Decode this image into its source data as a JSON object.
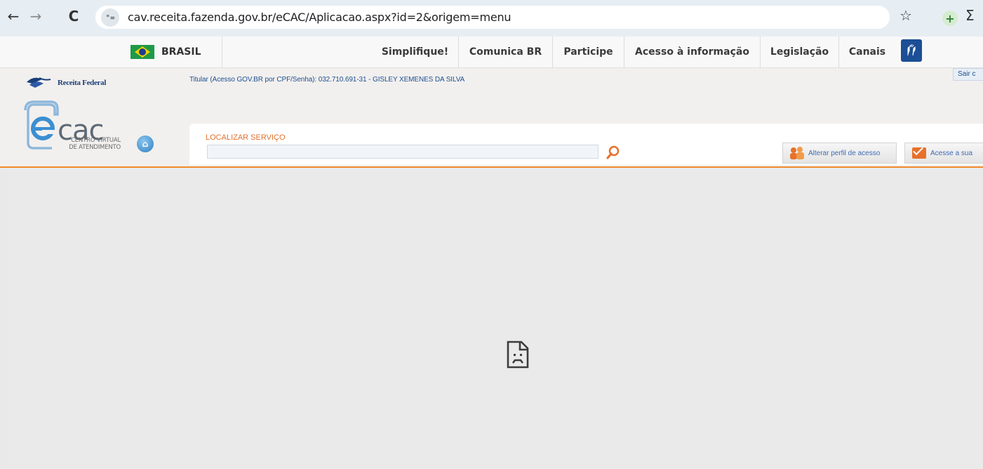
{
  "browser": {
    "back_icon": "←",
    "forward_icon": "→",
    "reload_icon": "C",
    "site_info_icon": "°=",
    "url": "cav.receita.fazenda.gov.br/eCAC/Aplicacao.aspx?id=2&origem=menu",
    "bookmark_icon": "☆",
    "extension_icon": "+",
    "puzzle_icon": "Σ"
  },
  "govbar": {
    "brasil": "BRASIL",
    "links": [
      "Simplifique!",
      "Comunica BR",
      "Participe",
      "Acesso à informação",
      "Legislação",
      "Canais"
    ]
  },
  "header": {
    "receita_federal": "Receita Federal",
    "titular": "Titular (Acesso GOV.BR por CPF/Senha): 032.710.691-31 - GISLEY XEMENES DA SILVA",
    "sair": "Sair c",
    "ecac_subtitle_line1": "CENTRO VIRTUAL",
    "ecac_subtitle_line2": "DE ATENDIMENTO",
    "search_label": "LOCALIZAR SERVIÇO",
    "search_placeholder": "",
    "alterar_perfil": "Alterar perfil de acesso",
    "caixa_postal": "Acesse a sua"
  },
  "colors": {
    "accent_orange": "#f08a2b",
    "link_blue": "#1d4f91"
  },
  "content": {
    "error_icon": "sad-document-icon"
  }
}
